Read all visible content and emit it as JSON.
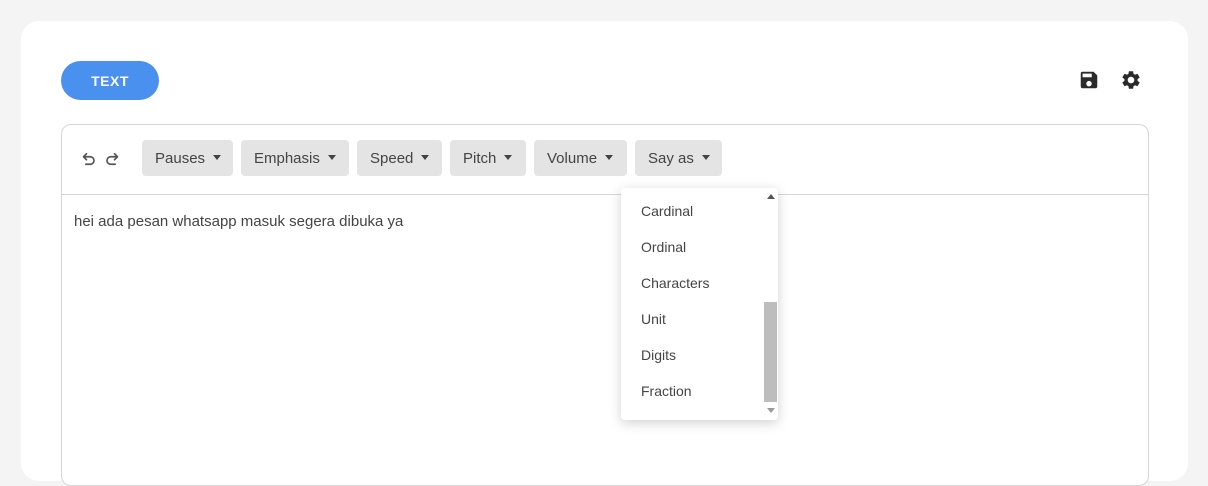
{
  "header": {
    "mode_label": "TEXT",
    "save_icon": "save-icon",
    "settings_icon": "gear-icon"
  },
  "toolbar": {
    "undo_icon": "undo-icon",
    "redo_icon": "redo-icon",
    "buttons": [
      {
        "label": "Pauses"
      },
      {
        "label": "Emphasis"
      },
      {
        "label": "Speed"
      },
      {
        "label": "Pitch"
      },
      {
        "label": "Volume"
      },
      {
        "label": "Say as"
      }
    ]
  },
  "editor": {
    "text": "hei ada pesan whatsapp masuk segera dibuka ya"
  },
  "sayas_menu": {
    "items": [
      {
        "label": "Cardinal"
      },
      {
        "label": "Ordinal"
      },
      {
        "label": "Characters"
      },
      {
        "label": "Unit"
      },
      {
        "label": "Digits"
      },
      {
        "label": "Fraction"
      }
    ]
  },
  "colors": {
    "accent": "#4a90ee",
    "background": "#f4f4f4",
    "toolbar_button": "#e4e4e4"
  }
}
